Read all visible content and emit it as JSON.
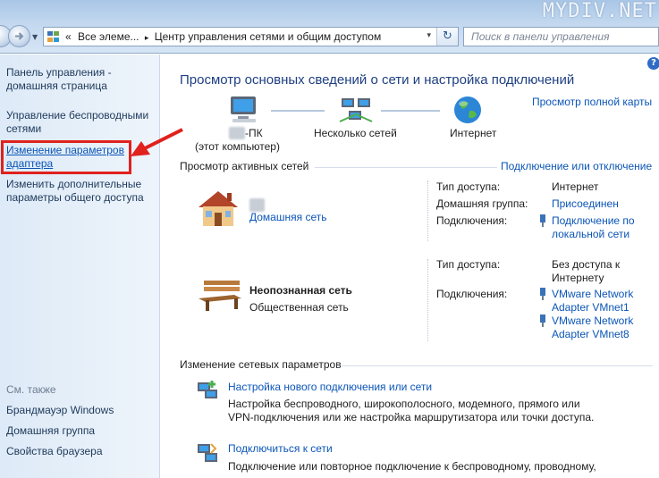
{
  "watermark": "MYDIV.NET",
  "address": {
    "prefix": "«",
    "crumb1": "Все элеме...",
    "sep": "▸",
    "crumb2": "Центр управления сетями и общим доступом",
    "dropdown": "▾",
    "refresh": "↻"
  },
  "search": {
    "placeholder": "Поиск в панели управления"
  },
  "sidebar": {
    "home_line1": "Панель управления -",
    "home_line2": "домашняя страница",
    "wireless_line1": "Управление беспроводными",
    "wireless_line2": "сетями",
    "adapter_line1": "Изменение параметров",
    "adapter_line2": "адаптера",
    "sharing_line1": "Изменить дополнительные",
    "sharing_line2": "параметры общего доступа",
    "see_also": "См. также",
    "firewall": "Брандмауэр Windows",
    "homegroup": "Домашняя группа",
    "browser": "Свойства браузера"
  },
  "help": "?",
  "main": {
    "title": "Просмотр основных сведений о сети и настройка подключений",
    "full_map": "Просмотр полной карты",
    "map": {
      "pc_name": "-ПК",
      "pc_sub": "(этот компьютер)",
      "networks": "Несколько сетей",
      "internet": "Интернет"
    },
    "active_head": "Просмотр активных сетей",
    "connect_link": "Подключение или отключение",
    "net1": {
      "name_hidden": "net",
      "type_link": "Домашняя сеть",
      "access_label": "Тип доступа:",
      "access_value": "Интернет",
      "homegroup_label": "Домашняя группа:",
      "homegroup_value": "Присоединен",
      "conn_label": "Подключения:",
      "conn_value_1": "Подключение по",
      "conn_value_2": "локальной сети"
    },
    "net2": {
      "name": "Неопознанная сеть",
      "type": "Общественная сеть",
      "access_label": "Тип доступа:",
      "access_value_1": "Без доступа к",
      "access_value_2": "Интернету",
      "conn_label": "Подключения:",
      "conn1_1": "VMware Network",
      "conn1_2": "Adapter VMnet1",
      "conn2_1": "VMware Network",
      "conn2_2": "Adapter VMnet8"
    },
    "change_head": "Изменение сетевых параметров",
    "task1": {
      "title": "Настройка нового подключения или сети",
      "desc1": "Настройка беспроводного, широкополосного, модемного, прямого или",
      "desc2": "VPN-подключения или же настройка маршрутизатора или точки доступа."
    },
    "task2": {
      "title": "Подключиться к сети",
      "desc1": "Подключение или повторное подключение к беспроводному, проводному,"
    }
  },
  "colors": {
    "link": "#0b55b7",
    "title": "#1e3f82",
    "highlight": "#e0211d"
  }
}
